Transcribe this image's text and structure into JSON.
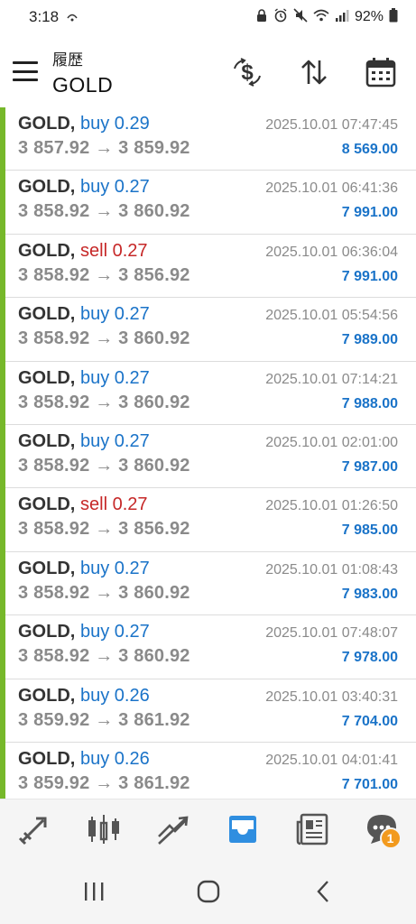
{
  "status_bar": {
    "time": "3:18",
    "battery": "92%"
  },
  "header": {
    "subtitle": "履歴",
    "title": "GOLD"
  },
  "trades": [
    {
      "symbol": "GOLD,",
      "side_class": "buy",
      "side": "buy 0.29",
      "prices": "3 857.92 → 3 859.92",
      "time": "2025.10.01 07:47:45",
      "balance": "8 569.00"
    },
    {
      "symbol": "GOLD,",
      "side_class": "buy",
      "side": "buy 0.27",
      "prices": "3 858.92 → 3 860.92",
      "time": "2025.10.01 06:41:36",
      "balance": "7 991.00"
    },
    {
      "symbol": "GOLD,",
      "side_class": "sell",
      "side": "sell 0.27",
      "prices": "3 858.92 → 3 856.92",
      "time": "2025.10.01 06:36:04",
      "balance": "7 991.00"
    },
    {
      "symbol": "GOLD,",
      "side_class": "buy",
      "side": "buy 0.27",
      "prices": "3 858.92 → 3 860.92",
      "time": "2025.10.01 05:54:56",
      "balance": "7 989.00"
    },
    {
      "symbol": "GOLD,",
      "side_class": "buy",
      "side": "buy 0.27",
      "prices": "3 858.92 → 3 860.92",
      "time": "2025.10.01 07:14:21",
      "balance": "7 988.00"
    },
    {
      "symbol": "GOLD,",
      "side_class": "buy",
      "side": "buy 0.27",
      "prices": "3 858.92 → 3 860.92",
      "time": "2025.10.01 02:01:00",
      "balance": "7 987.00"
    },
    {
      "symbol": "GOLD,",
      "side_class": "sell",
      "side": "sell 0.27",
      "prices": "3 858.92 → 3 856.92",
      "time": "2025.10.01 01:26:50",
      "balance": "7 985.00"
    },
    {
      "symbol": "GOLD,",
      "side_class": "buy",
      "side": "buy 0.27",
      "prices": "3 858.92 → 3 860.92",
      "time": "2025.10.01 01:08:43",
      "balance": "7 983.00"
    },
    {
      "symbol": "GOLD,",
      "side_class": "buy",
      "side": "buy 0.27",
      "prices": "3 858.92 → 3 860.92",
      "time": "2025.10.01 07:48:07",
      "balance": "7 978.00"
    },
    {
      "symbol": "GOLD,",
      "side_class": "buy",
      "side": "buy 0.26",
      "prices": "3 859.92 → 3 861.92",
      "time": "2025.10.01 03:40:31",
      "balance": "7 704.00"
    },
    {
      "symbol": "GOLD,",
      "side_class": "buy",
      "side": "buy 0.26",
      "prices": "3 859.92 → 3 861.92",
      "time": "2025.10.01 04:01:41",
      "balance": "7 701.00"
    }
  ],
  "bottom_nav": {
    "items": [
      "quotes-icon",
      "chart-icon",
      "trade-icon",
      "history-icon",
      "news-icon",
      "chat-icon"
    ],
    "active": "history-icon",
    "chat_badge": "1",
    "accent_color": "#2f8ee0",
    "badge_color": "#f29a1e"
  },
  "colors": {
    "buy": "#1a73c8",
    "sell": "#c62828",
    "row_bar": "#76b82a"
  }
}
